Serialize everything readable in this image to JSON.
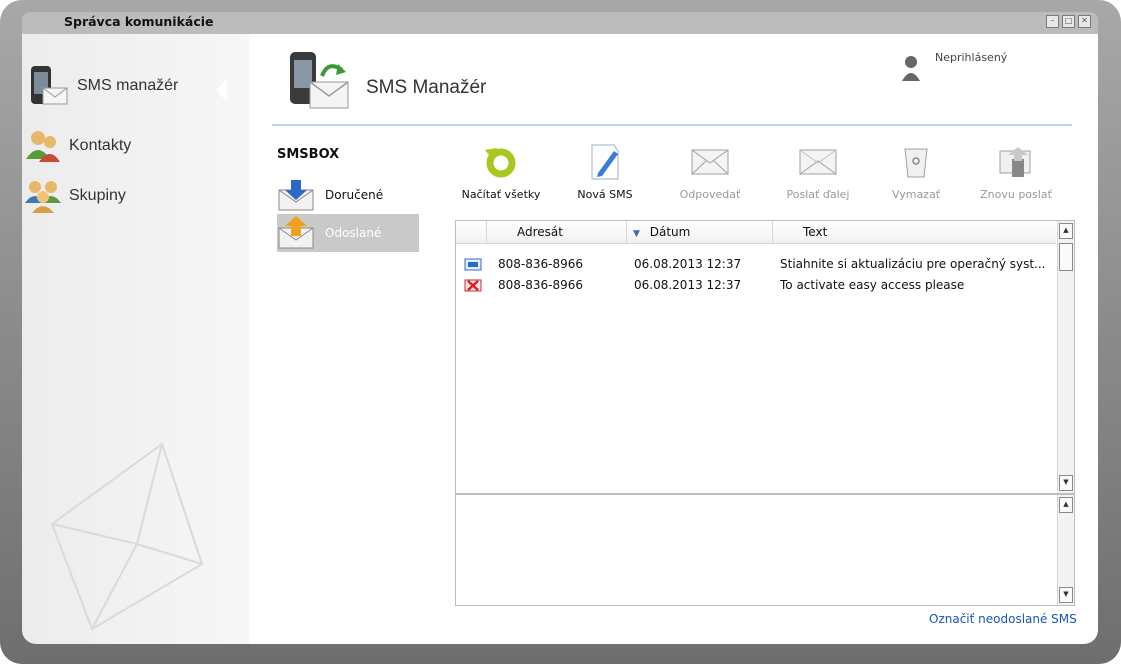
{
  "window": {
    "title": "Správca komunikácie"
  },
  "sidebar": {
    "items": [
      {
        "label": "SMS manažér",
        "icon": "phone-envelope-icon",
        "active": true
      },
      {
        "label": "Kontakty",
        "icon": "contacts-icon"
      },
      {
        "label": "Skupiny",
        "icon": "groups-icon"
      }
    ]
  },
  "header": {
    "title": "SMS Manažér",
    "icon": "sms-manager-icon",
    "user_status": "Neprihlásený"
  },
  "smsbox": {
    "title": "SMSBOX",
    "folders": [
      {
        "label": "Doručené",
        "icon": "inbox-arrow-down-icon"
      },
      {
        "label": "Odoslané",
        "icon": "outbox-arrow-up-icon",
        "selected": true
      }
    ]
  },
  "toolbar": {
    "items": [
      {
        "label": "Načítať všetky",
        "icon": "refresh-icon",
        "enabled": true
      },
      {
        "label": "Nová SMS",
        "icon": "new-sms-icon",
        "enabled": true
      },
      {
        "label": "Odpovedať",
        "icon": "reply-envelope-icon",
        "enabled": false
      },
      {
        "label": "Poslať ďalej",
        "icon": "forward-envelope-icon",
        "enabled": false
      },
      {
        "label": "Vymazať",
        "icon": "trash-icon",
        "enabled": false
      },
      {
        "label": "Znovu poslať",
        "icon": "resend-icon",
        "enabled": false
      }
    ]
  },
  "table": {
    "columns": [
      "Adresát",
      "Dátum",
      "Text"
    ],
    "sort_column": "Dátum",
    "rows": [
      {
        "status_icon": "sent-ok-icon",
        "address": "808-836-8966",
        "date": "06.08.2013 12:37",
        "text": "Stiahnite si aktualizáciu pre operačný syst..."
      },
      {
        "status_icon": "sent-failed-icon",
        "address": "808-836-8966",
        "date": "06.08.2013 12:37",
        "text": "To activate easy access please"
      }
    ]
  },
  "footer": {
    "link": "Označiť neodoslané SMS"
  },
  "colors": {
    "link": "#1a55b8",
    "frame": "#8a8a8a",
    "selection": "#c9c9c9",
    "accent_line": "#c6d4e2"
  }
}
